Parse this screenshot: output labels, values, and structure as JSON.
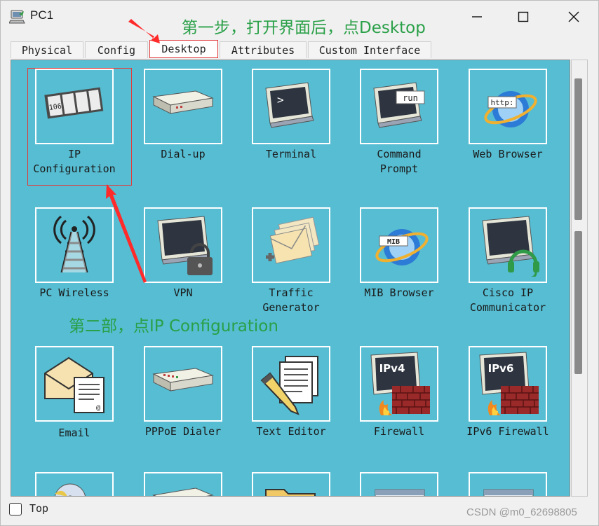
{
  "window": {
    "title": "PC1"
  },
  "tabs": [
    {
      "label": "Physical",
      "active": false
    },
    {
      "label": "Config",
      "active": false
    },
    {
      "label": "Desktop",
      "active": true
    },
    {
      "label": "Attributes",
      "active": false
    },
    {
      "label": "Custom Interface",
      "active": false
    }
  ],
  "apps": [
    {
      "label": [
        "IP",
        "Configuration"
      ],
      "icon": "ip-configuration-icon"
    },
    {
      "label": [
        "Dial-up"
      ],
      "icon": "dial-up-modem-icon"
    },
    {
      "label": [
        "Terminal"
      ],
      "icon": "terminal-icon"
    },
    {
      "label": [
        "Command",
        "Prompt"
      ],
      "icon": "command-prompt-icon"
    },
    {
      "label": [
        "Web Browser"
      ],
      "icon": "web-browser-icon"
    },
    {
      "label": [
        "PC Wireless"
      ],
      "icon": "wireless-tower-icon"
    },
    {
      "label": [
        "VPN"
      ],
      "icon": "vpn-lock-icon"
    },
    {
      "label": [
        "Traffic",
        "Generator"
      ],
      "icon": "traffic-generator-icon"
    },
    {
      "label": [
        "MIB Browser"
      ],
      "icon": "mib-browser-icon"
    },
    {
      "label": [
        "Cisco IP",
        "Communicator"
      ],
      "icon": "ip-communicator-icon"
    },
    {
      "label": [
        "Email"
      ],
      "icon": "email-icon"
    },
    {
      "label": [
        "PPPoE Dialer"
      ],
      "icon": "pppoe-dialer-icon"
    },
    {
      "label": [
        "Text Editor"
      ],
      "icon": "text-editor-icon"
    },
    {
      "label": [
        "Firewall"
      ],
      "icon": "firewall-icon"
    },
    {
      "label": [
        "IPv6 Firewall"
      ],
      "icon": "ipv6-firewall-icon"
    }
  ],
  "icon_text": {
    "ip_config": "106",
    "command_prompt": "run",
    "web_browser": "http:",
    "mib_browser": "MIB",
    "firewall": "IPv4",
    "ipv6_firewall": "IPv6"
  },
  "annotations": {
    "step1": "第一步，打开界面后，点Desktop",
    "step2": "第二部，点IP Configuration"
  },
  "footer": {
    "top_checkbox_label": "Top",
    "top_checked": false,
    "watermark": "CSDN @m0_62698805"
  },
  "colors": {
    "content_bg": "#56bdd2",
    "annotation_green": "#2aa048",
    "highlight_red": "#e23b3b"
  }
}
